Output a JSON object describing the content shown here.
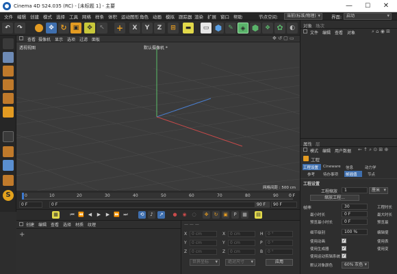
{
  "window": {
    "title": "Cinema 4D S24.035 (RC) - [未标题 1] - 主要",
    "minimize": "—",
    "maximize": "☐",
    "close": "✕"
  },
  "menubar": {
    "items": [
      "文件",
      "编辑",
      "创建",
      "模式",
      "选择",
      "工具",
      "网格",
      "样条",
      "体积",
      "运动图形",
      "角色",
      "动画",
      "模拟",
      "跟踪器",
      "渲染",
      "扩展",
      "窗口",
      "帮助"
    ],
    "node_space_label": "节点空间:",
    "node_space_value": "当前(标准/物理)",
    "layout_label": "界面:",
    "layout_value": "启动"
  },
  "toolbar": {
    "x": "X",
    "y": "Y",
    "z": "Z"
  },
  "viewport": {
    "menu": [
      "查看",
      "摄像机",
      "显示",
      "选项",
      "过滤",
      "面板"
    ],
    "view_name": "透视视图",
    "camera": "默认摄像机 *",
    "grid_spacing": "网格间距 : 500 cm"
  },
  "timeline": {
    "ticks": [
      "0",
      "10",
      "20",
      "30",
      "40",
      "50",
      "60",
      "70",
      "80",
      "90"
    ],
    "start": "0 F",
    "current": "0 F",
    "end": "90 F",
    "end2": "90 F",
    "frame_marker": "0 F"
  },
  "material": {
    "menu": [
      "创建",
      "编辑",
      "查看",
      "选择",
      "材质",
      "纹理"
    ],
    "add": "+"
  },
  "coords": {
    "rows": [
      {
        "a": "X",
        "av": "0 cm",
        "b": "X",
        "bv": "0 cm",
        "c": "H",
        "cv": "0 °"
      },
      {
        "a": "Y",
        "av": "0 cm",
        "b": "Y",
        "bv": "0 cm",
        "c": "P",
        "cv": "0 °"
      },
      {
        "a": "Z",
        "av": "0 cm",
        "b": "Z",
        "bv": "0 cm",
        "c": "B",
        "cv": "0 °"
      }
    ],
    "mode1": "世界坐标",
    "mode2": "绝对尺寸",
    "apply": "应用"
  },
  "objects": {
    "tabs": [
      "对象",
      "场次"
    ],
    "menu": [
      "文件",
      "编辑",
      "查看",
      "对象"
    ]
  },
  "attributes": {
    "tabs": [
      "属性",
      "层"
    ],
    "menu": [
      "模式",
      "编辑",
      "用户数据"
    ],
    "object_name": "工程",
    "subtabs1": [
      "工程设置",
      "Cineware",
      "信息",
      "动力学"
    ],
    "subtabs2": [
      "参考",
      "待办事项",
      "帧插值",
      "节点"
    ],
    "section": "工程设置",
    "scale_label": "工程缩放",
    "scale_value": "1",
    "scale_unit": "厘米",
    "scale_button": "缩放工程...",
    "rows": [
      {
        "label": "帧率",
        "value": "30",
        "side": "工程时长"
      },
      {
        "label": "最小时长",
        "value": "0 F",
        "side": "最大时长"
      },
      {
        "label": "预览最小时长",
        "value": "0 F",
        "side": "预览最"
      },
      {
        "label": "细节级别",
        "value": "100 %",
        "side": "编辑使"
      }
    ],
    "checks": [
      {
        "label": "使用动画",
        "side": "使用表"
      },
      {
        "label": "使用生成器",
        "side": "使用变"
      },
      {
        "label": "使用运动剪辑系统",
        "side": ""
      }
    ],
    "default_color_label": "默认对象颜色",
    "default_color_value": "60% 灰色"
  }
}
